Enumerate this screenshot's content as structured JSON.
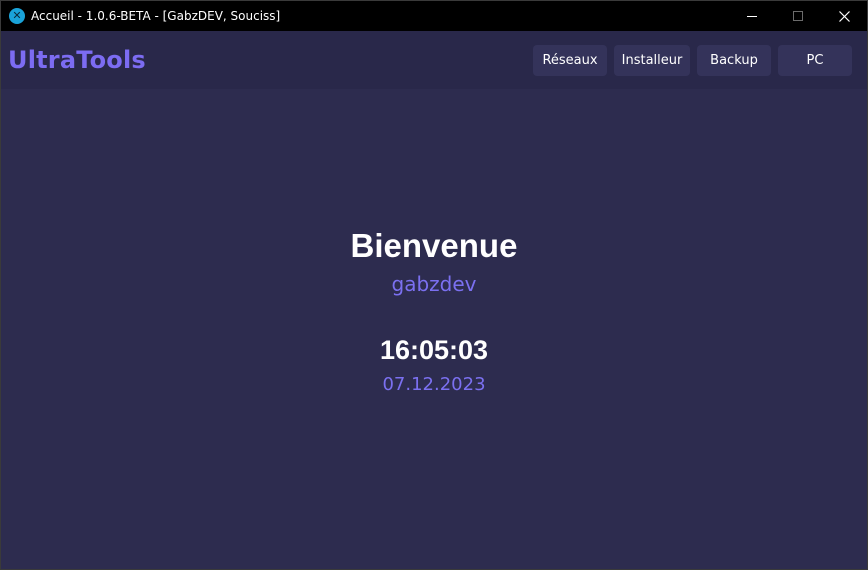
{
  "window": {
    "title": "Accueil - 1.0.6-BETA - [GabzDEV, Souciss]",
    "icon": "app-logo-icon",
    "minimize_glyph": "—",
    "maximize_glyph": "☐",
    "close_glyph": "✕"
  },
  "header": {
    "brand": "UltraTools",
    "nav": [
      {
        "label": "Réseaux"
      },
      {
        "label": "Installeur"
      },
      {
        "label": "Backup"
      },
      {
        "label": "PC"
      }
    ]
  },
  "main": {
    "welcome": "Bienvenue",
    "username": "gabzdev",
    "time": "16:05:03",
    "date": "07.12.2023"
  },
  "colors": {
    "background": "#2d2c4f",
    "header_background": "#29284a",
    "accent": "#7b70f0",
    "button_background": "#34335a",
    "titlebar": "#000000"
  }
}
